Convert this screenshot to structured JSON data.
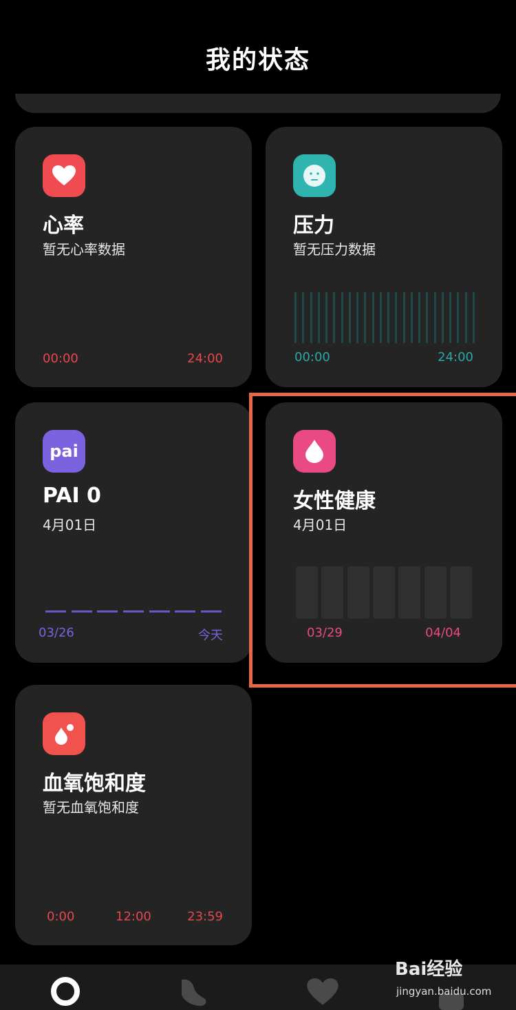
{
  "header": {
    "title": "我的状态"
  },
  "cards": {
    "heart_rate": {
      "title": "心率",
      "subtitle": "暂无心率数据",
      "axis_start": "00:00",
      "axis_end": "24:00",
      "accent": "#f04b50",
      "icon": "heart-icon"
    },
    "stress": {
      "title": "压力",
      "subtitle": "暂无压力数据",
      "axis_start": "00:00",
      "axis_end": "24:00",
      "accent": "#2fb4b0",
      "icon": "neutral-face-icon"
    },
    "pai": {
      "title": "PAI 0",
      "subtitle": "4月01日",
      "axis_start": "03/26",
      "axis_end": "今天",
      "accent": "#7b63e0",
      "icon_text": "pai",
      "icon": "pai-logo-icon"
    },
    "female_health": {
      "title": "女性健康",
      "subtitle": "4月01日",
      "axis_start": "03/29",
      "axis_end": "04/04",
      "accent": "#e94a84",
      "icon": "drop-icon"
    },
    "blood_oxygen": {
      "title": "血氧饱和度",
      "subtitle": "暂无血氧饱和度",
      "axis_start": "0:00",
      "axis_mid": "12:00",
      "axis_end": "23:59",
      "accent": "#f0524d",
      "icon": "oxygen-drops-icon"
    }
  },
  "highlight_color": "#e8664a",
  "bottom_nav": {
    "items": [
      {
        "icon": "status-ring-icon",
        "active": true
      },
      {
        "icon": "shoe-icon",
        "active": false
      },
      {
        "icon": "heart-icon",
        "active": false
      },
      {
        "icon": "profile-icon",
        "active": false
      }
    ]
  },
  "watermark": {
    "brand": "Bai经验",
    "url": "jingyan.baidu.com"
  }
}
